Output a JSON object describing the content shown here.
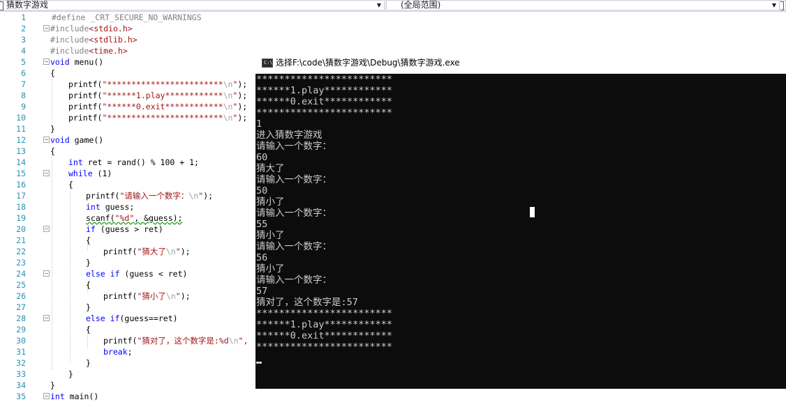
{
  "topbar": {
    "scope_left": "猜数字游戏",
    "scope_right": "(全局范围)"
  },
  "editor": {
    "line_numbers": [
      "1",
      "2",
      "3",
      "4",
      "5",
      "6",
      "7",
      "8",
      "9",
      "10",
      "11",
      "12",
      "13",
      "14",
      "15",
      "16",
      "17",
      "18",
      "19",
      "20",
      "21",
      "22",
      "23",
      "24",
      "25",
      "26",
      "27",
      "28",
      "29",
      "30",
      "31",
      "32",
      "33",
      "34",
      "35"
    ],
    "lines": {
      "l1": "#define _CRT_SECURE_NO_WARNINGS",
      "l2a": "#include",
      "l2b": "<stdio.h>",
      "l3a": "#include",
      "l3b": "<stdlib.h>",
      "l4a": "#include",
      "l4b": "<time.h>",
      "l5a": "void",
      "l5b": " menu()",
      "l6": "{",
      "l7a": "printf(",
      "l7b": "\"************************",
      "l7c": "\\n",
      "l7d": "\"",
      "l7e": ");",
      "l8a": "printf(",
      "l8b": "\"******1.play************",
      "l8c": "\\n",
      "l8d": "\"",
      "l8e": ");",
      "l9a": "printf(",
      "l9b": "\"******0.exit************",
      "l9c": "\\n",
      "l9d": "\"",
      "l9e": ");",
      "l10a": "printf(",
      "l10b": "\"************************",
      "l10c": "\\n",
      "l10d": "\"",
      "l10e": ");",
      "l11": "}",
      "l12a": "void",
      "l12b": " game()",
      "l13": "{",
      "l14a": "int",
      "l14b": " ret = rand() % 100 + 1;",
      "l15a": "while",
      "l15b": " (1)",
      "l16": "{",
      "l17a": "printf(",
      "l17b": "\"请输入一个数字：",
      "l17c": "\\n",
      "l17d": "\"",
      "l17e": ");",
      "l18a": "int",
      "l18b": " guess;",
      "l19a": "scanf(",
      "l19b": "\"%d\"",
      "l19c": ", &guess);",
      "l20a": "if",
      "l20b": " (guess > ret)",
      "l21": "{",
      "l22a": "printf(",
      "l22b": "\"猜大了",
      "l22c": "\\n",
      "l22d": "\"",
      "l22e": ");",
      "l23": "}",
      "l24a": "else",
      "l24b": " ",
      "l24c": "if",
      "l24d": " (guess < ret)",
      "l25": "{",
      "l26a": "printf(",
      "l26b": "\"猜小了",
      "l26c": "\\n",
      "l26d": "\"",
      "l26e": ");",
      "l27": "}",
      "l28a": "else",
      "l28b": " ",
      "l28c": "if",
      "l28d": "(guess==ret)",
      "l29": "{",
      "l30a": "printf(",
      "l30b": "\"猜对了，这个数字是:%d",
      "l30c": "\\n",
      "l30d": "\",",
      "l31a": "break",
      "l31b": ";",
      "l32": "}",
      "l33": "}",
      "l34": "}",
      "l35a": "int",
      "l35b": " main()"
    }
  },
  "console": {
    "title": "选择F:\\code\\猜数字游戏\\Debug\\猜数字游戏.exe",
    "icon_label": "C:\\",
    "lines": [
      "************************",
      "******1.play************",
      "******0.exit************",
      "************************",
      "1",
      "进入猜数字游戏",
      "请输入一个数字：",
      "60",
      "猜大了",
      "请输入一个数字：",
      "50",
      "猜小了",
      "请输入一个数字：",
      "55",
      "猜小了",
      "请输入一个数字：",
      "56",
      "猜小了",
      "请输入一个数字：",
      "57",
      "猜对了，这个数字是:57",
      "************************",
      "******1.play************",
      "******0.exit************",
      "************************"
    ]
  },
  "colors": {
    "keyword": "#0000ff",
    "string": "#a31515",
    "preprocessor": "#808080",
    "line_number": "#2b91af",
    "console_bg": "#0c0c0c",
    "console_text": "#cccccc"
  }
}
